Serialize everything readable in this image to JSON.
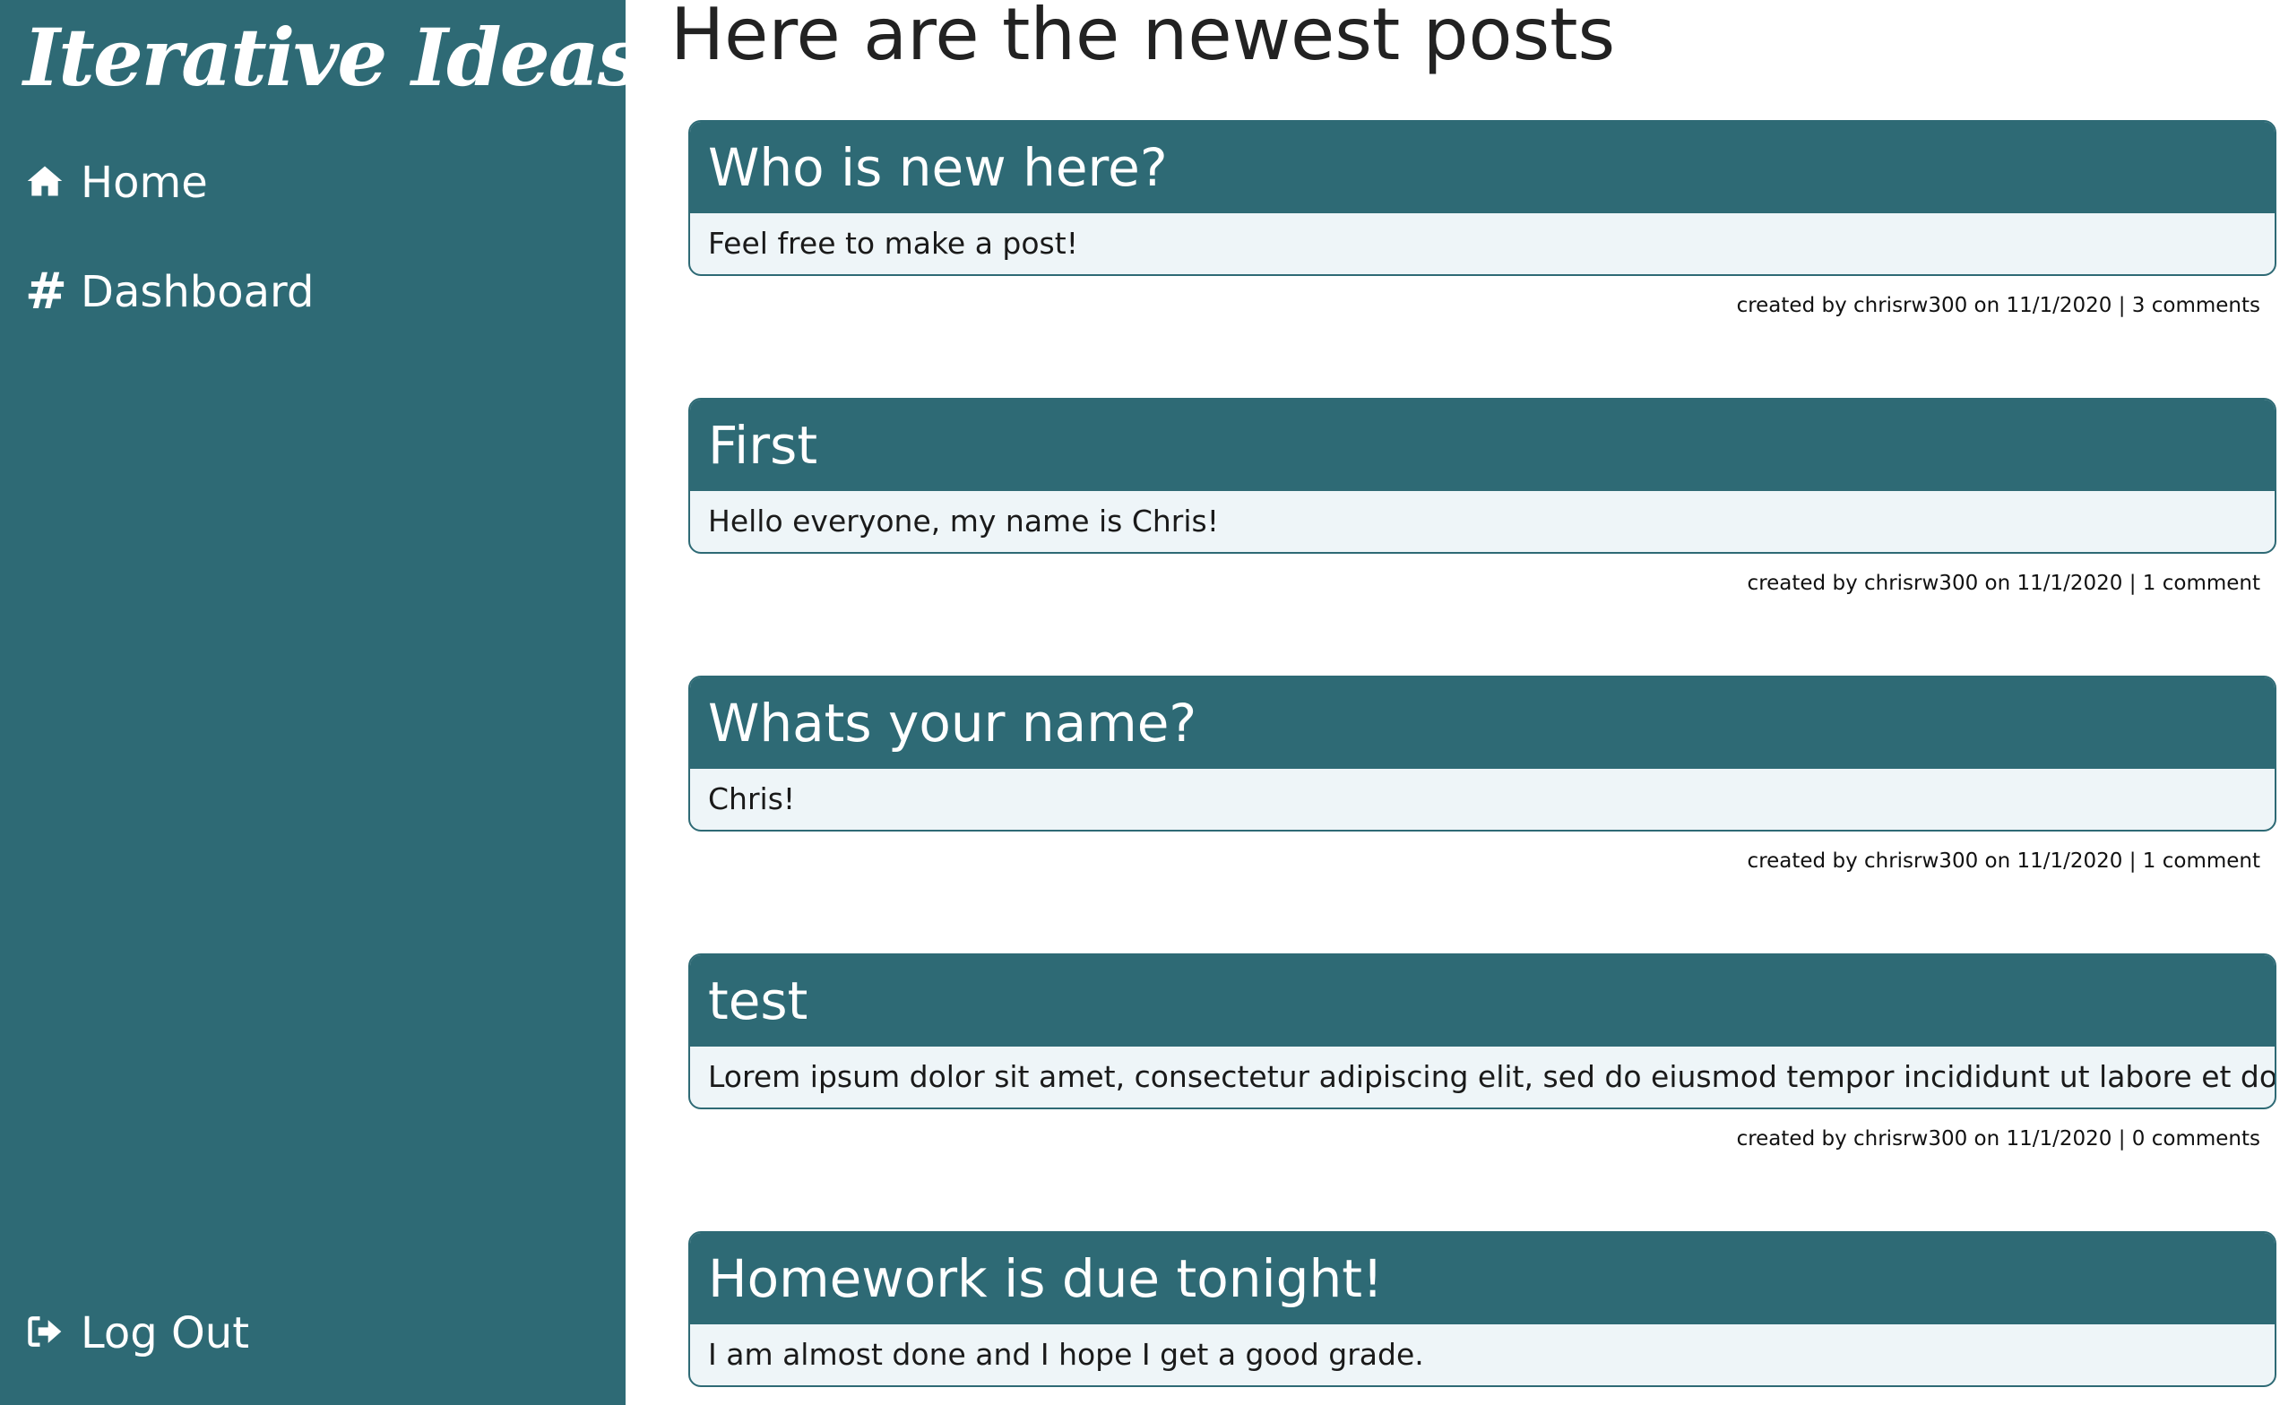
{
  "brand": "Iterative Ideas",
  "nav": {
    "home": "Home",
    "dashboard": "Dashboard",
    "dashboard_icon": "#",
    "logout": "Log Out"
  },
  "icons": {
    "home": "home-icon",
    "dashboard": "hash-icon",
    "logout": "sign-out-icon"
  },
  "colors": {
    "sidebar": "#2e6a75",
    "card_header": "#2e6a75",
    "card_body": "#eef5f8"
  },
  "main": {
    "title": "Here are the newest posts"
  },
  "posts": [
    {
      "title": "Who is new here?",
      "body": "Feel free to make a post!",
      "meta": "created by chrisrw300 on 11/1/2020 | 3 comments"
    },
    {
      "title": "First",
      "body": "Hello everyone, my name is Chris!",
      "meta": "created by chrisrw300 on 11/1/2020 | 1 comment"
    },
    {
      "title": "Whats your name?",
      "body": "Chris!",
      "meta": "created by chrisrw300 on 11/1/2020 | 1 comment"
    },
    {
      "title": "test",
      "body": "Lorem ipsum dolor sit amet, consectetur adipiscing elit, sed do eiusmod tempor incididunt ut labore et dolor",
      "meta": "created by chrisrw300 on 11/1/2020 | 0 comments"
    },
    {
      "title": "Homework is due tonight!",
      "body": "I am almost done and I hope I get a good grade.",
      "meta": ""
    }
  ]
}
